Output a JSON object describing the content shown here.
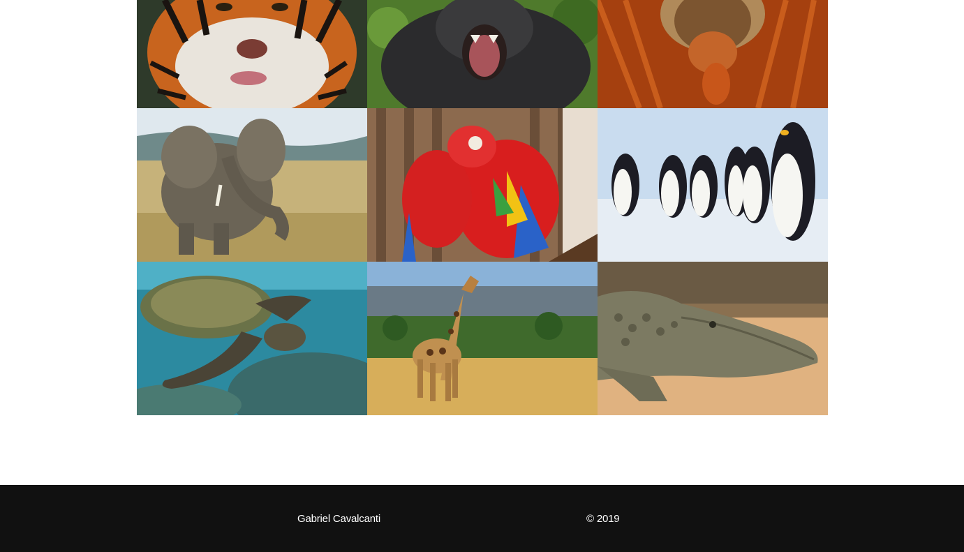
{
  "gallery": {
    "tiles": [
      {
        "icon": "tiger-photo"
      },
      {
        "icon": "gorilla-photo"
      },
      {
        "icon": "orangutan-photo"
      },
      {
        "icon": "elephant-photo"
      },
      {
        "icon": "macaw-photo"
      },
      {
        "icon": "penguin-photo"
      },
      {
        "icon": "sea-turtle-photo"
      },
      {
        "icon": "giraffe-photo"
      },
      {
        "icon": "crocodile-photo"
      }
    ]
  },
  "footer": {
    "author": "Gabriel Cavalcanti",
    "copyright": "© 2019",
    "background": "#111111"
  }
}
